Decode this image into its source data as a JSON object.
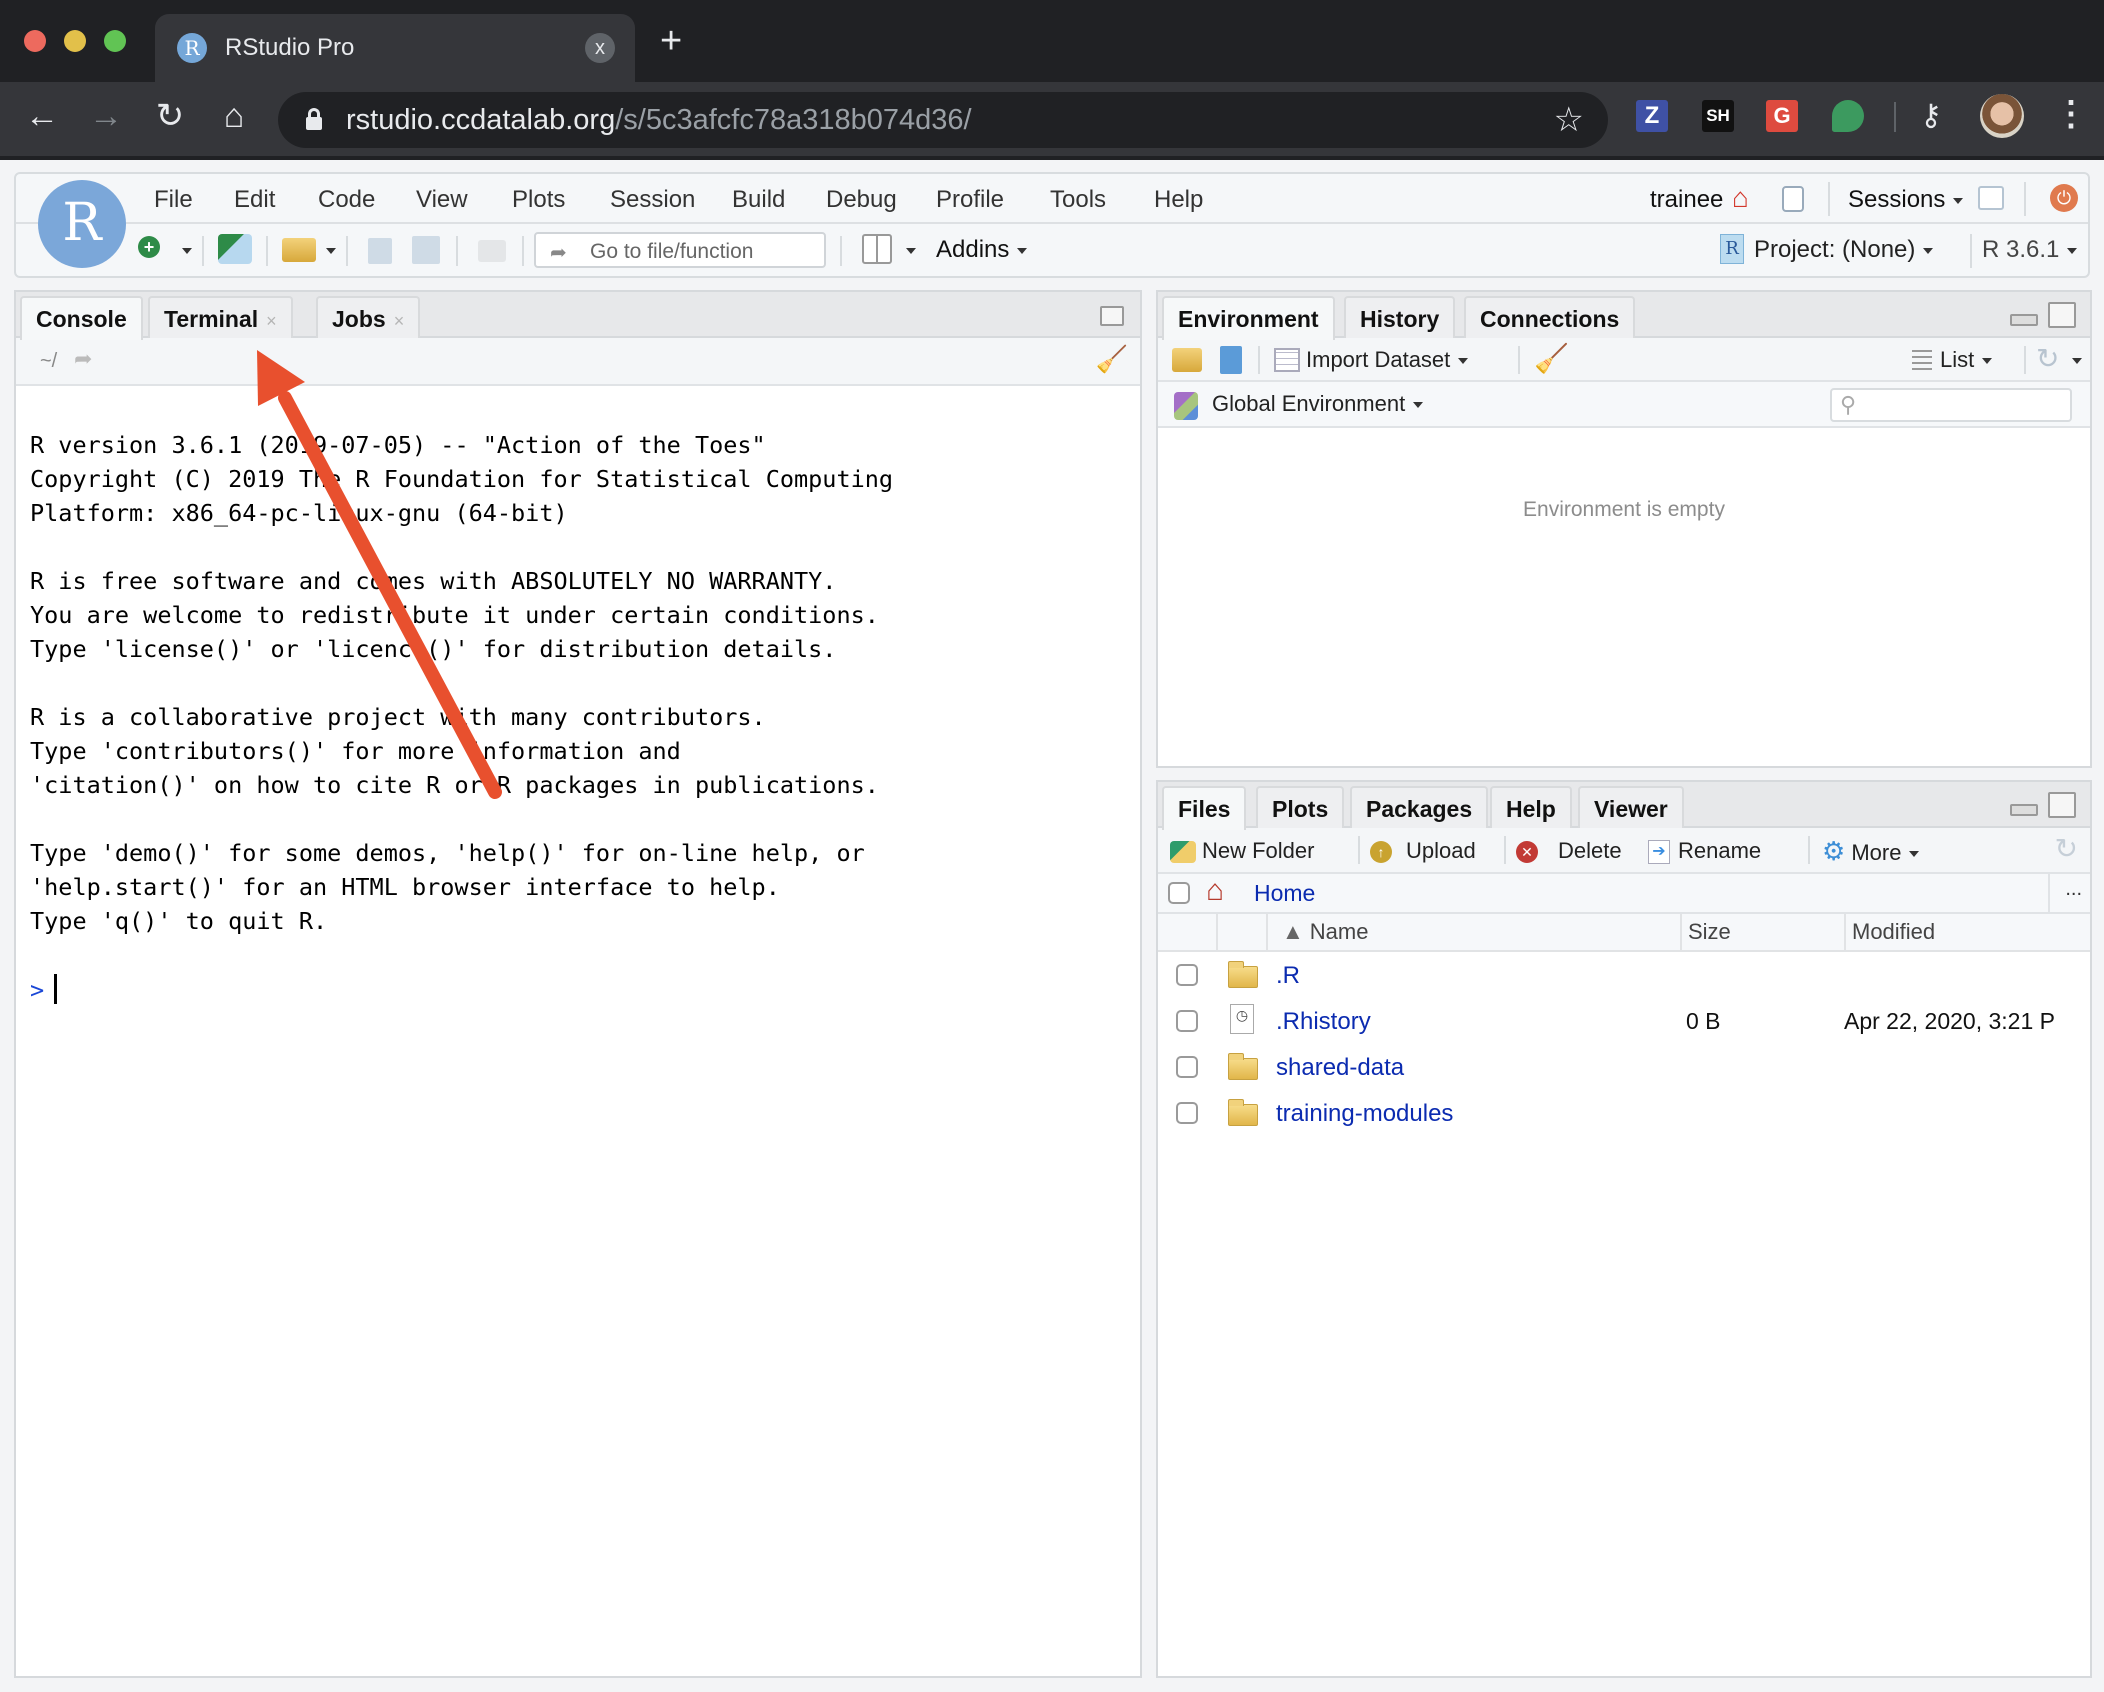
{
  "browser": {
    "tab_title": "RStudio Pro",
    "tab_close": "x",
    "new_tab": "+",
    "url_host": "rstudio.ccdatalab.org",
    "url_path": "/s/5c3afcfc78a318b074d36/",
    "nav": {
      "back": "←",
      "forward": "→",
      "reload": "↻",
      "home": "⌂"
    },
    "extensions": [
      {
        "name": "zotero-extension",
        "label": "Z",
        "color": "#3f51a5"
      },
      {
        "name": "sh-extension",
        "label": "SH",
        "color": "#111111"
      },
      {
        "name": "grammarly-extension",
        "label": "G",
        "color": "#de4b3f"
      },
      {
        "name": "chat-extension",
        "label": "",
        "color": "#3c9a5f"
      }
    ],
    "menu_icon": "⋮"
  },
  "rstudio": {
    "logo": "R",
    "menu": [
      "File",
      "Edit",
      "Code",
      "View",
      "Plots",
      "Session",
      "Build",
      "Debug",
      "Profile",
      "Tools",
      "Help"
    ],
    "user": "trainee",
    "sessions_label": "Sessions",
    "goto_placeholder": "Go to file/function",
    "addins_label": "Addins",
    "project_label": "Project: (None)",
    "r_version": "R 3.6.1"
  },
  "console_pane": {
    "tabs": [
      {
        "label": "Console",
        "active": true
      },
      {
        "label": "Terminal",
        "closable": true
      },
      {
        "label": "Jobs",
        "closable": true
      }
    ],
    "close_glyph": "×",
    "working_dir": "~/",
    "lines": [
      "R version 3.6.1 (2019-07-05) -- \"Action of the Toes\"",
      "Copyright (C) 2019 The R Foundation for Statistical Computing",
      "Platform: x86_64-pc-linux-gnu (64-bit)",
      "",
      "R is free software and comes with ABSOLUTELY NO WARRANTY.",
      "You are welcome to redistribute it under certain conditions.",
      "Type 'license()' or 'licence()' for distribution details.",
      "",
      "R is a collaborative project with many contributors.",
      "Type 'contributors()' for more information and",
      "'citation()' on how to cite R or R packages in publications.",
      "",
      "Type 'demo()' for some demos, 'help()' for on-line help, or",
      "'help.start()' for an HTML browser interface to help.",
      "Type 'q()' to quit R."
    ],
    "prompt": ">"
  },
  "env_pane": {
    "tabs": [
      {
        "label": "Environment",
        "active": true
      },
      {
        "label": "History"
      },
      {
        "label": "Connections"
      }
    ],
    "import_label": "Import Dataset",
    "list_label": "List",
    "scope_label": "Global Environment",
    "search_placeholder": "",
    "empty_message": "Environment is empty"
  },
  "files_pane": {
    "tabs": [
      {
        "label": "Files",
        "active": true
      },
      {
        "label": "Plots"
      },
      {
        "label": "Packages"
      },
      {
        "label": "Help"
      },
      {
        "label": "Viewer"
      }
    ],
    "toolbar": {
      "new_folder": "New Folder",
      "upload": "Upload",
      "delete": "Delete",
      "rename": "Rename",
      "more": "More"
    },
    "breadcrumb": "Home",
    "overflow": "...",
    "columns": {
      "name": "Name",
      "size": "Size",
      "modified": "Modified",
      "sort_glyph": "▲"
    },
    "rows": [
      {
        "name": ".R",
        "type": "folder",
        "size": "",
        "modified": ""
      },
      {
        "name": ".Rhistory",
        "type": "file",
        "size": "0 B",
        "modified": "Apr 22, 2020, 3:21 P"
      },
      {
        "name": "shared-data",
        "type": "folder",
        "size": "",
        "modified": ""
      },
      {
        "name": "training-modules",
        "type": "folder",
        "size": "",
        "modified": ""
      }
    ]
  },
  "annotation": {
    "color": "#e8502e",
    "points_to": "Terminal tab"
  }
}
